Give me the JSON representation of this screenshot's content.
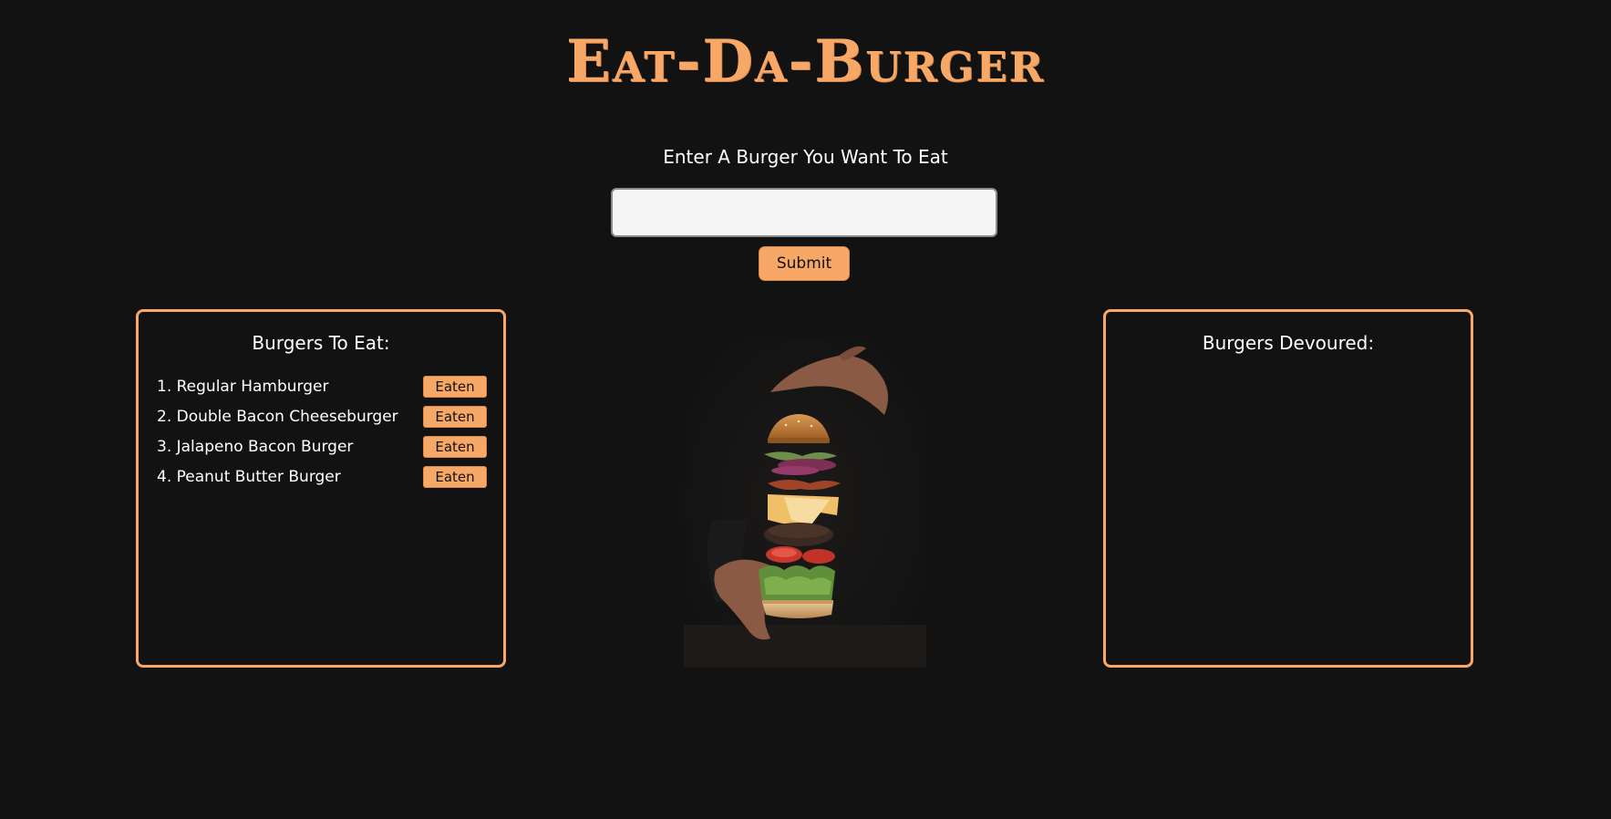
{
  "header": {
    "title": "Eat-Da-Burger"
  },
  "form": {
    "prompt": "Enter A Burger You Want To Eat",
    "input_value": "",
    "input_placeholder": "",
    "submit_label": "Submit"
  },
  "to_eat": {
    "heading": "Burgers To Eat:",
    "items": [
      {
        "label": "1. Regular Hamburger",
        "button": "Eaten"
      },
      {
        "label": "2. Double Bacon Cheeseburger",
        "button": "Eaten"
      },
      {
        "label": "3. Jalapeno Bacon Burger",
        "button": "Eaten"
      },
      {
        "label": "4. Peanut Butter Burger",
        "button": "Eaten"
      }
    ]
  },
  "devoured": {
    "heading": "Burgers Devoured:",
    "items": []
  },
  "colors": {
    "background": "#121212",
    "accent": "#f7a867",
    "text": "#ffffff",
    "input_bg": "#f5f5f5"
  }
}
